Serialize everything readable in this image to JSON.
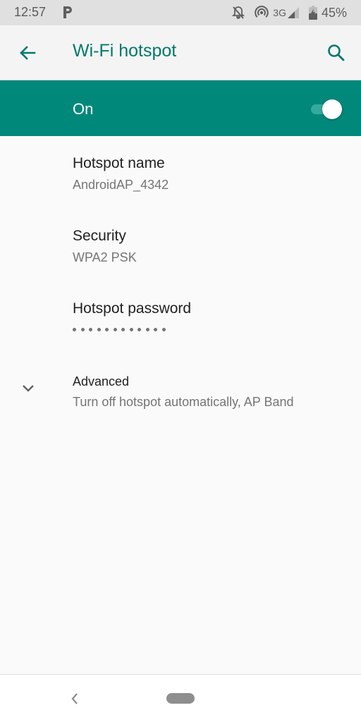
{
  "status_bar": {
    "time": "12:57",
    "notification_icon": "parking-p-icon",
    "icons": [
      "bell-off-icon",
      "hotspot-icon",
      "signal-icon",
      "battery-charging-icon"
    ],
    "network_type": "3G",
    "battery": "45%"
  },
  "app_bar": {
    "back_icon": "arrow-back-icon",
    "title": "Wi-Fi hotspot",
    "search_icon": "search-icon"
  },
  "master_switch": {
    "label": "On",
    "checked": true
  },
  "preferences": [
    {
      "title": "Hotspot name",
      "summary": "AndroidAP_4342"
    },
    {
      "title": "Security",
      "summary": "WPA2 PSK"
    },
    {
      "title": "Hotspot password",
      "masked_length": 12
    },
    {
      "title": "Advanced",
      "summary": "Turn off hotspot automatically, AP Band",
      "icon": "chevron-down-icon"
    }
  ],
  "nav_bar": {
    "back_icon": "nav-back-icon",
    "home_icon": "home-pill-icon"
  },
  "colors": {
    "accent": "#00796b",
    "master_bar": "#00897b",
    "status_bar": "#e0e0e0",
    "app_bar": "#f4f4f4",
    "background": "#fafafa"
  }
}
